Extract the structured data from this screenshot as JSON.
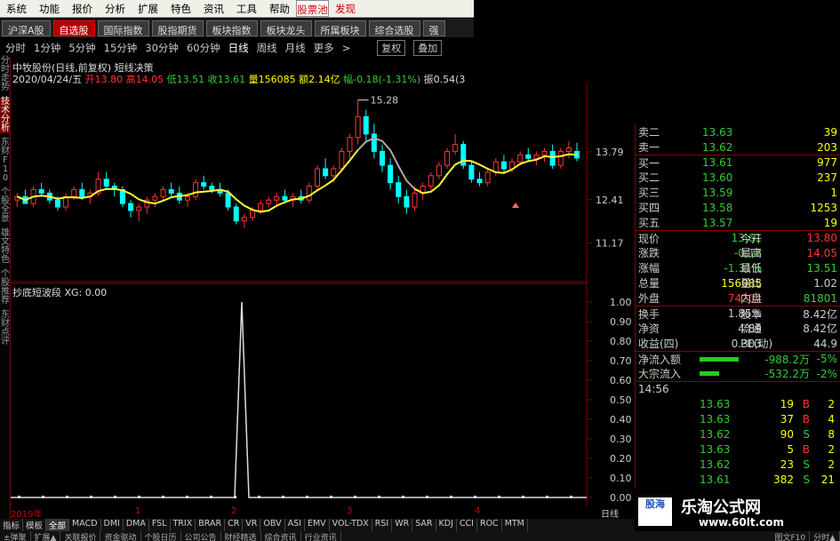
{
  "menu": [
    "系统",
    "功能",
    "报价",
    "分析",
    "扩展",
    "特色",
    "资讯",
    "工具",
    "帮助",
    "股票池",
    "发现"
  ],
  "tabs": [
    "沪深A股",
    "自选股",
    "国际指数",
    "股指期货",
    "板块指数",
    "板块龙头",
    "所属板块",
    "综合选股",
    "强"
  ],
  "periods": [
    "分时",
    "1分钟",
    "5分钟",
    "15分钟",
    "30分钟",
    "60分钟",
    "日线",
    "周线",
    "月线",
    "更多"
  ],
  "period_more_arrow": ">",
  "period_buttons": [
    "复权",
    "叠加"
  ],
  "left_strip": [
    "分时走势",
    "技术分析",
    "东财F10",
    "个股全景",
    "雄文特色",
    "个股推荐",
    "东财点评"
  ],
  "chart": {
    "title": "中牧股份(日线,前复权) 短线决策",
    "date": "2020/04/24/五",
    "open_label": "开",
    "open": "13.80",
    "high_label": "高",
    "high": "14.05",
    "low_label": "低",
    "low": "13.51",
    "close_label": "收",
    "close": "13.61",
    "vol_label": "量",
    "vol": "156085",
    "amount_label": "额",
    "amount": "2.14亿",
    "chg_label": "幅",
    "chg": "-0.18(-1.31%)",
    "amp_label": "振",
    "amp": "0.54(3",
    "peak_label": "15.28",
    "sub_title": "抄底短波段",
    "sub_value": "XG: 0.00",
    "x_labels": [
      "2019年",
      "1",
      "2",
      "3",
      "4"
    ],
    "period_label": "日线"
  },
  "chart_data": {
    "type": "candlestick",
    "price_axis": [
      "13.79",
      "12.41",
      "11.17"
    ],
    "sub_axis": [
      "1.00",
      "0.90",
      "0.80",
      "0.70",
      "0.60",
      "0.50",
      "0.40",
      "0.30",
      "0.20",
      "0.10",
      "0.00"
    ],
    "sub_ylim": [
      0,
      1
    ],
    "candles": [
      [
        12.4,
        12.6,
        12.2,
        12.5
      ],
      [
        12.5,
        12.7,
        12.3,
        12.3
      ],
      [
        12.3,
        12.8,
        12.2,
        12.7
      ],
      [
        12.7,
        12.9,
        12.5,
        12.6
      ],
      [
        12.6,
        12.7,
        12.3,
        12.4
      ],
      [
        12.4,
        12.5,
        12.1,
        12.2
      ],
      [
        12.2,
        12.6,
        12.1,
        12.5
      ],
      [
        12.5,
        12.8,
        12.4,
        12.7
      ],
      [
        12.7,
        12.9,
        12.4,
        12.5
      ],
      [
        12.5,
        12.7,
        12.3,
        12.6
      ],
      [
        12.6,
        13.2,
        12.5,
        13.0
      ],
      [
        13.0,
        13.2,
        12.7,
        12.8
      ],
      [
        12.8,
        12.9,
        12.5,
        12.7
      ],
      [
        12.7,
        12.8,
        12.2,
        12.3
      ],
      [
        12.3,
        12.4,
        11.9,
        12.1
      ],
      [
        12.1,
        12.3,
        11.8,
        12.2
      ],
      [
        12.2,
        12.5,
        12.0,
        12.4
      ],
      [
        12.4,
        12.6,
        12.2,
        12.5
      ],
      [
        12.5,
        12.8,
        12.4,
        12.7
      ],
      [
        12.7,
        12.9,
        12.5,
        12.6
      ],
      [
        12.6,
        12.8,
        12.3,
        12.4
      ],
      [
        12.4,
        12.6,
        12.2,
        12.5
      ],
      [
        12.5,
        13.0,
        12.4,
        12.9
      ],
      [
        12.9,
        13.1,
        12.7,
        12.8
      ],
      [
        12.8,
        12.9,
        12.6,
        12.7
      ],
      [
        12.7,
        12.9,
        12.5,
        12.6
      ],
      [
        12.6,
        12.7,
        12.1,
        12.2
      ],
      [
        12.2,
        12.3,
        11.7,
        11.8
      ],
      [
        11.8,
        12.0,
        11.6,
        11.9
      ],
      [
        11.9,
        12.2,
        11.8,
        12.1
      ],
      [
        12.1,
        12.4,
        12.0,
        12.3
      ],
      [
        12.3,
        12.5,
        12.2,
        12.4
      ],
      [
        12.4,
        12.6,
        12.2,
        12.5
      ],
      [
        12.5,
        12.7,
        12.3,
        12.4
      ],
      [
        12.4,
        12.6,
        12.2,
        12.5
      ],
      [
        12.5,
        12.7,
        12.3,
        12.4
      ],
      [
        12.4,
        12.9,
        12.3,
        12.8
      ],
      [
        12.8,
        13.4,
        12.7,
        13.3
      ],
      [
        13.3,
        13.6,
        13.0,
        13.1
      ],
      [
        13.1,
        13.4,
        12.9,
        13.3
      ],
      [
        13.3,
        13.9,
        13.2,
        13.8
      ],
      [
        13.8,
        14.3,
        13.6,
        14.2
      ],
      [
        14.2,
        15.28,
        14.0,
        14.8
      ],
      [
        14.8,
        15.0,
        14.1,
        14.3
      ],
      [
        14.3,
        14.6,
        13.6,
        13.8
      ],
      [
        13.8,
        14.0,
        13.2,
        13.4
      ],
      [
        13.4,
        13.6,
        12.7,
        12.9
      ],
      [
        12.9,
        13.1,
        12.3,
        12.5
      ],
      [
        12.5,
        12.7,
        12.0,
        12.2
      ],
      [
        12.2,
        12.8,
        12.1,
        12.6
      ],
      [
        12.6,
        12.9,
        12.4,
        12.8
      ],
      [
        12.8,
        13.2,
        12.7,
        13.1
      ],
      [
        13.1,
        13.5,
        13.0,
        13.4
      ],
      [
        13.4,
        13.9,
        13.3,
        13.8
      ],
      [
        13.8,
        14.3,
        13.7,
        14.0
      ],
      [
        14.0,
        14.1,
        13.3,
        13.4
      ],
      [
        13.4,
        13.5,
        12.9,
        13.0
      ],
      [
        13.0,
        13.2,
        12.8,
        12.9
      ],
      [
        12.9,
        13.3,
        12.8,
        13.2
      ],
      [
        13.2,
        13.6,
        13.1,
        13.5
      ],
      [
        13.5,
        13.7,
        13.2,
        13.3
      ],
      [
        13.3,
        13.6,
        13.2,
        13.5
      ],
      [
        13.5,
        13.8,
        13.4,
        13.7
      ],
      [
        13.7,
        13.9,
        13.5,
        13.6
      ],
      [
        13.6,
        13.8,
        13.4,
        13.7
      ],
      [
        13.7,
        13.9,
        13.5,
        13.8
      ],
      [
        13.8,
        14.0,
        13.3,
        13.4
      ],
      [
        13.4,
        13.9,
        13.3,
        13.8
      ],
      [
        13.8,
        14.1,
        13.6,
        13.9
      ],
      [
        13.8,
        14.05,
        13.51,
        13.61
      ]
    ],
    "signal_index": 33,
    "signal_value": 1.0
  },
  "quote": {
    "ask2_label": "卖二",
    "ask2": "13.63",
    "ask2_vol": "39",
    "ask1_label": "卖一",
    "ask1": "13.62",
    "ask1_vol": "203",
    "bids": [
      {
        "label": "买一",
        "price": "13.61",
        "vol": "977"
      },
      {
        "label": "买二",
        "price": "13.60",
        "vol": "237"
      },
      {
        "label": "买三",
        "price": "13.59",
        "vol": "1"
      },
      {
        "label": "买四",
        "price": "13.58",
        "vol": "1253"
      },
      {
        "label": "买五",
        "price": "13.57",
        "vol": "19"
      }
    ],
    "stats": [
      [
        "现价",
        "13.61",
        "今开",
        "13.80"
      ],
      [
        "涨跌",
        "-0.18",
        "最高",
        "14.05"
      ],
      [
        "涨幅",
        "-1.31%",
        "最低",
        "13.51"
      ],
      [
        "总量",
        "156085",
        "量比",
        "1.02"
      ],
      [
        "外盘",
        "74204",
        "内盘",
        "81801"
      ]
    ],
    "stats2": [
      [
        "换手",
        "1.85%",
        "股本",
        "8.42亿"
      ],
      [
        "净资",
        "4.89",
        "流通",
        "8.42亿"
      ],
      [
        "收益(四)",
        "0.303",
        "PE(动)",
        "44.9"
      ]
    ],
    "flow": [
      {
        "label": "净流入额",
        "value": "-988.2万",
        "pct": "-5%"
      },
      {
        "label": "大宗流入",
        "value": "-532.2万",
        "pct": "-2%"
      }
    ],
    "time": "14:56",
    "ticks": [
      {
        "price": "13.63",
        "vol": "19",
        "side": "B",
        "n": "2"
      },
      {
        "price": "13.63",
        "vol": "37",
        "side": "B",
        "n": "4"
      },
      {
        "price": "13.62",
        "vol": "90",
        "side": "S",
        "n": "8"
      },
      {
        "price": "13.63",
        "vol": "5",
        "side": "B",
        "n": "2"
      },
      {
        "price": "13.62",
        "vol": "23",
        "side": "S",
        "n": "2"
      },
      {
        "price": "13.61",
        "vol": "382",
        "side": "S",
        "n": "21"
      }
    ]
  },
  "indicators": [
    "指标",
    "模板",
    "全部",
    "MACD",
    "DMI",
    "DMA",
    "FSL",
    "TRIX",
    "BRAR",
    "CR",
    "VR",
    "OBV",
    "ASI",
    "EMV",
    "VOL-TDX",
    "RSI",
    "WR",
    "SAR",
    "KDJ",
    "CCI",
    "ROC",
    "MTM"
  ],
  "info_tabs": [
    "±弹聚",
    "扩展▲",
    "关联报价",
    "资金驱动",
    "个股日历",
    "公司公告",
    "财经精选",
    "综合资讯",
    "行业资讯"
  ],
  "info_right": [
    "图文F10",
    "分时▲"
  ],
  "watermark": {
    "stamp": "股海",
    "title": "乐淘公式网",
    "url": "www.60lt.com"
  },
  "colors": {
    "up": "#ff3333",
    "down": "#00ffff",
    "ma": "#ffff33",
    "ma2": "#aaaaaa",
    "signal": "#dddddd",
    "grid": "#800000"
  }
}
